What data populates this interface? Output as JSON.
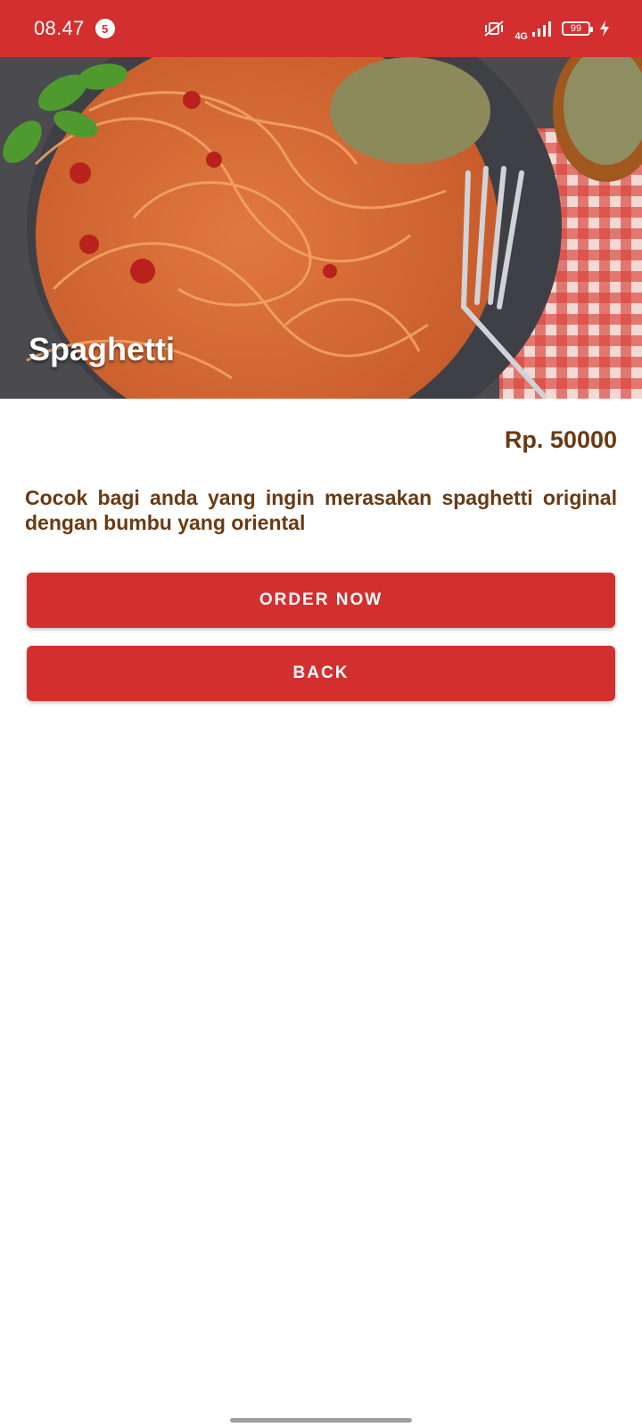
{
  "status_bar": {
    "time": "08.47",
    "notification_count": "5",
    "network": "4G",
    "battery": "99"
  },
  "hero": {
    "title": "Spaghetti"
  },
  "product": {
    "price": "Rp. 50000",
    "description": "Cocok bagi anda yang ingin merasakan spaghetti original dengan bumbu yang oriental"
  },
  "actions": {
    "order_label": "ORDER NOW",
    "back_label": "BACK"
  },
  "colors": {
    "primary": "#d32f2f",
    "text_brown": "#6b3a12"
  }
}
